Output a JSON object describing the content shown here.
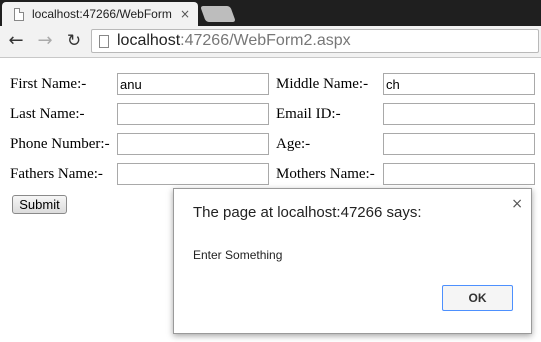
{
  "browser": {
    "tab_title": "localhost:47266/WebForm",
    "tab_close": "×",
    "url_host": "localhost",
    "url_rest": ":47266/WebForm2.aspx",
    "back_glyph": "←",
    "forward_glyph": "→",
    "reload_glyph": "↻"
  },
  "form": {
    "first_name_label": "First Name:-",
    "first_name_value": "anu",
    "middle_name_label": "Middle Name:-",
    "middle_name_value": "ch",
    "last_name_label": "Last Name:-",
    "last_name_value": "",
    "email_label": "Email ID:-",
    "email_value": "",
    "phone_label": "Phone Number:-",
    "phone_value": "",
    "age_label": "Age:-",
    "age_value": "",
    "fathers_name_label": "Fathers Name:-",
    "fathers_name_value": "",
    "mothers_name_label": "Mothers Name:-",
    "mothers_name_value": "",
    "submit_label": "Submit"
  },
  "dialog": {
    "title": "The page at localhost:47266 says:",
    "message": "Enter Something",
    "ok_label": "OK",
    "close_glyph": "×",
    "accent_color": "#4d90fe"
  }
}
